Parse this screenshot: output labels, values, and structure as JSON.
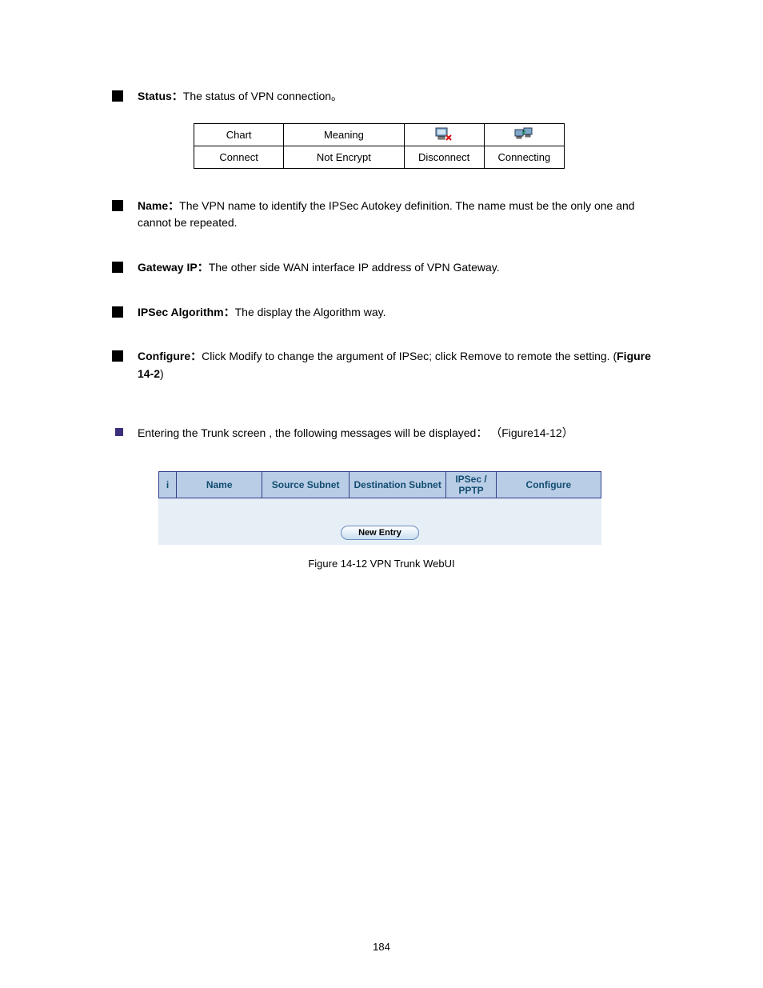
{
  "bullets": {
    "status": {
      "term": "Status：",
      "text": "The status of VPN connection",
      "dot": "。"
    },
    "name": {
      "term": "Name：",
      "text": "The VPN name to identify the IPSec Autokey definition. The name must be the only one and cannot be repeated."
    },
    "gateway": {
      "term": "Gateway IP：",
      "text": "The other side WAN interface IP address of VPN Gateway."
    },
    "algorithm": {
      "term": "IPSec Algorithm：",
      "text": "The display the Algorithm way."
    },
    "configure": {
      "term": "Configure：",
      "text": "Click Modify to change the argument of IPSec; click Remove to remote the setting. (",
      "figref": "Figure 14-2",
      "tail": ")"
    }
  },
  "status_table": {
    "r1": {
      "c1": "Chart",
      "c2": "Meaning"
    },
    "r2": {
      "c1": "Connect",
      "c2": "Not Encrypt",
      "c3": "Disconnect",
      "c4": "Connecting"
    }
  },
  "trunk_entry": {
    "lead": "Entering the Trunk screen , the following messages will be displayed：",
    "figref": "（Figure14-12）"
  },
  "vpn_table": {
    "col_i": "i",
    "col_name": "Name",
    "col_src": "Source Subnet",
    "col_dst": "Destination Subnet",
    "col_ip": "IPSec / PPTP",
    "col_cfg": "Configure",
    "button": "New Entry"
  },
  "figure_caption": "Figure 14-12   VPN Trunk WebUI",
  "page_number": "184"
}
